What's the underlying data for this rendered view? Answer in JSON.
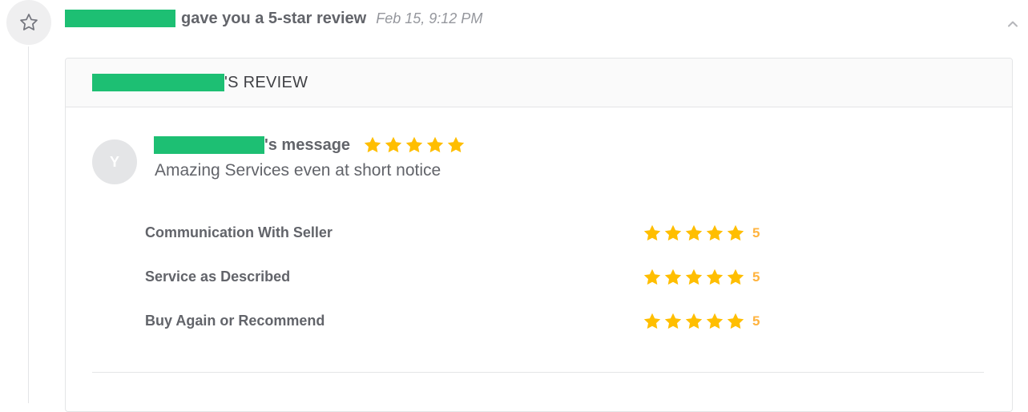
{
  "event": {
    "icon": "star-outline-icon",
    "headline": "gave you a 5-star review",
    "timestamp": "Feb 15, 9:12 PM",
    "collapse_icon": "chevron-up-icon"
  },
  "review_card": {
    "title_suffix": "'S REVIEW",
    "avatar_initial": "Y",
    "message_suffix": "'s message",
    "overall_rating": 5,
    "message_text": "Amazing Services even at short notice",
    "ratings": [
      {
        "label": "Communication With Seller",
        "value": "5",
        "stars": 5
      },
      {
        "label": "Service as Described",
        "value": "5",
        "stars": 5
      },
      {
        "label": "Buy Again or Recommend",
        "value": "5",
        "stars": 5
      }
    ]
  },
  "colors": {
    "redaction": "#1dbf73",
    "star": "#ffbe00",
    "rating_value": "#ffb33e",
    "text": "#62646a",
    "muted": "#95979d"
  }
}
